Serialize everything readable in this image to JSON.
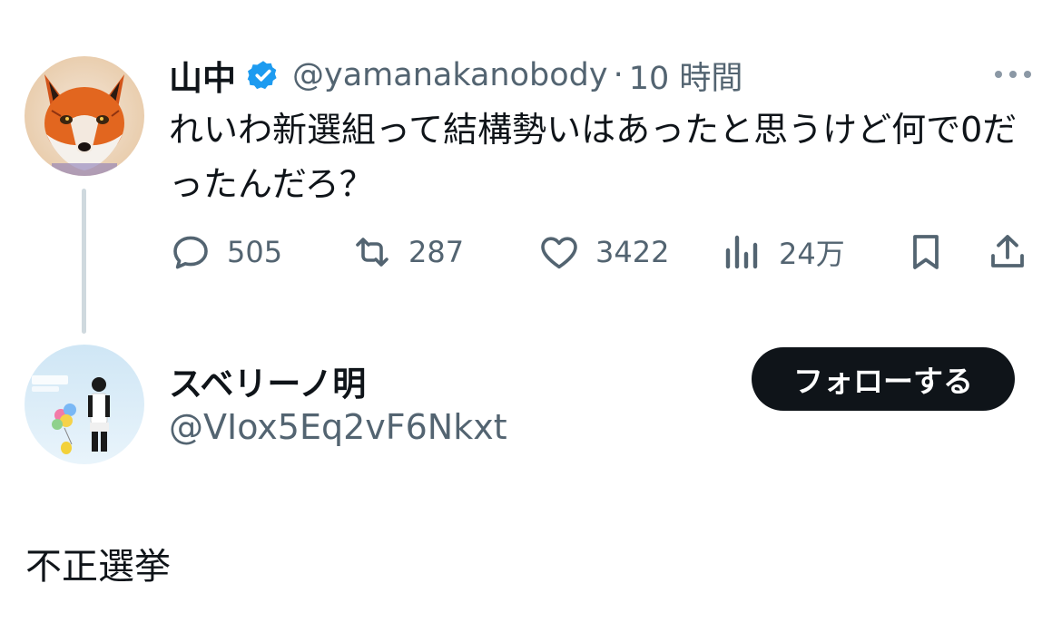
{
  "original_tweet": {
    "display_name": "山中",
    "handle": "@yamanakanobody",
    "separator": "·",
    "time": "10 時間",
    "text": "れいわ新選組って結構勢いはあったと思うけど何で0だったんだろ？",
    "avatar_icon": "fox-avatar",
    "verified_icon": "verified-badge-icon",
    "more_icon": "more-options-icon",
    "metrics": {
      "replies": "505",
      "retweets": "287",
      "likes": "3422",
      "views": "24万"
    }
  },
  "reply_author": {
    "display_name": "スベリーノ明",
    "handle": "@VIox5Eq2vF6Nkxt",
    "follow_label": "フォローする",
    "avatar_icon": "game-character-avatar"
  },
  "reply": {
    "text": "不正選挙"
  },
  "colors": {
    "text_primary": "#0f1419",
    "text_secondary": "#536471",
    "verified_blue": "#1d9bf0",
    "follow_button_bg": "#0f1419",
    "thread_line": "#cfd9de"
  }
}
